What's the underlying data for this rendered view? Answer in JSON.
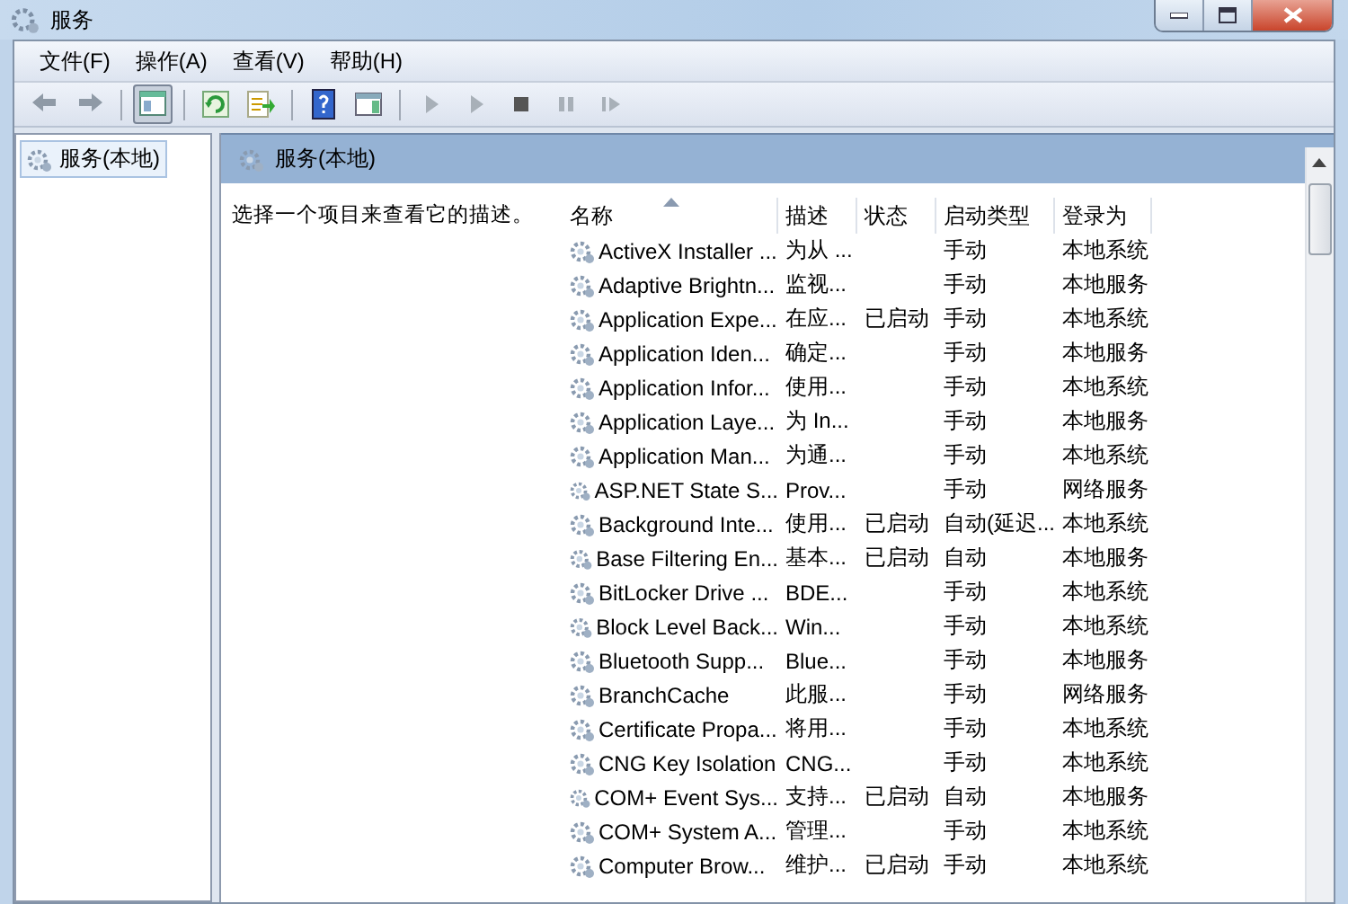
{
  "window": {
    "title": "服务"
  },
  "menu": [
    "文件(F)",
    "操作(A)",
    "查看(V)",
    "帮助(H)"
  ],
  "toolbar": [
    {
      "kind": "back"
    },
    {
      "kind": "forward"
    },
    {
      "kind": "sep"
    },
    {
      "kind": "tree",
      "pressed": true
    },
    {
      "kind": "sep"
    },
    {
      "kind": "refresh"
    },
    {
      "kind": "export"
    },
    {
      "kind": "sep"
    },
    {
      "kind": "help"
    },
    {
      "kind": "pane"
    },
    {
      "kind": "sep"
    },
    {
      "kind": "play"
    },
    {
      "kind": "play"
    },
    {
      "kind": "stop"
    },
    {
      "kind": "pause"
    },
    {
      "kind": "resume"
    }
  ],
  "tree": {
    "items": [
      {
        "label": "服务(本地)",
        "selected": true
      }
    ]
  },
  "panel": {
    "title": "服务(本地)",
    "description": "选择一个项目来查看它的描述。"
  },
  "table": {
    "columns": [
      {
        "label": "名称",
        "sorted": true
      },
      {
        "label": "描述",
        "sorted": false
      },
      {
        "label": "状态",
        "sorted": false
      },
      {
        "label": "启动类型",
        "sorted": false
      },
      {
        "label": "登录为",
        "sorted": false
      }
    ],
    "rows": [
      {
        "name": "ActiveX Installer ...",
        "description": "为从 ...",
        "status": "",
        "startup": "手动",
        "logon": "本地系统"
      },
      {
        "name": "Adaptive Brightn...",
        "description": "监视...",
        "status": "",
        "startup": "手动",
        "logon": "本地服务"
      },
      {
        "name": "Application Expe...",
        "description": "在应...",
        "status": "已启动",
        "startup": "手动",
        "logon": "本地系统"
      },
      {
        "name": "Application Iden...",
        "description": "确定...",
        "status": "",
        "startup": "手动",
        "logon": "本地服务"
      },
      {
        "name": "Application Infor...",
        "description": "使用...",
        "status": "",
        "startup": "手动",
        "logon": "本地系统"
      },
      {
        "name": "Application Laye...",
        "description": "为 In...",
        "status": "",
        "startup": "手动",
        "logon": "本地服务"
      },
      {
        "name": "Application Man...",
        "description": "为通...",
        "status": "",
        "startup": "手动",
        "logon": "本地系统"
      },
      {
        "name": "ASP.NET State S...",
        "description": "Prov...",
        "status": "",
        "startup": "手动",
        "logon": "网络服务"
      },
      {
        "name": "Background Inte...",
        "description": "使用...",
        "status": "已启动",
        "startup": "自动(延迟...",
        "logon": "本地系统"
      },
      {
        "name": "Base Filtering En...",
        "description": "基本...",
        "status": "已启动",
        "startup": "自动",
        "logon": "本地服务"
      },
      {
        "name": "BitLocker Drive ...",
        "description": "BDE...",
        "status": "",
        "startup": "手动",
        "logon": "本地系统"
      },
      {
        "name": "Block Level Back...",
        "description": "Win...",
        "status": "",
        "startup": "手动",
        "logon": "本地系统"
      },
      {
        "name": "Bluetooth Supp...",
        "description": "Blue...",
        "status": "",
        "startup": "手动",
        "logon": "本地服务"
      },
      {
        "name": "BranchCache",
        "description": "此服...",
        "status": "",
        "startup": "手动",
        "logon": "网络服务"
      },
      {
        "name": "Certificate Propa...",
        "description": "将用...",
        "status": "",
        "startup": "手动",
        "logon": "本地系统"
      },
      {
        "name": "CNG Key Isolation",
        "description": "CNG...",
        "status": "",
        "startup": "手动",
        "logon": "本地系统"
      },
      {
        "name": "COM+ Event Sys...",
        "description": "支持...",
        "status": "已启动",
        "startup": "自动",
        "logon": "本地服务"
      },
      {
        "name": "COM+ System A...",
        "description": "管理...",
        "status": "",
        "startup": "手动",
        "logon": "本地系统"
      },
      {
        "name": "Computer Brow...",
        "description": "维护...",
        "status": "已启动",
        "startup": "手动",
        "logon": "本地系统"
      }
    ]
  }
}
